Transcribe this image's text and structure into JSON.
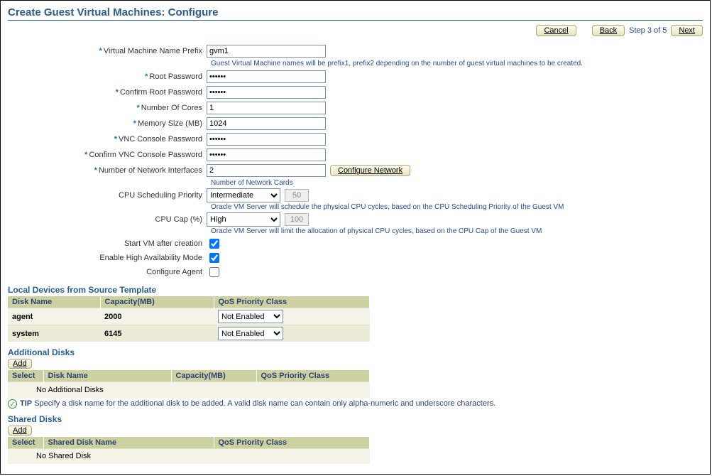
{
  "page": {
    "title": "Create Guest Virtual Machines: Configure",
    "step_text": "Step 3 of 5",
    "cancel": "Cancel",
    "back": "Back",
    "next": "Next"
  },
  "form": {
    "vm_name_label": "Virtual Machine Name Prefix",
    "vm_name_value": "gvm1",
    "vm_name_hint": "Guest Virtual Machine names will be prefix1, prefix2 depending on the number of guest virtual machines to be created.",
    "root_pw_label": "Root Password",
    "root_pw_value": "••••••",
    "confirm_root_pw_label": "Confirm Root Password",
    "confirm_root_pw_value": "••••••",
    "cores_label": "Number Of Cores",
    "cores_value": "1",
    "memory_label": "Memory Size (MB)",
    "memory_value": "1024",
    "vnc_pw_label": "VNC Console Password",
    "vnc_pw_value": "••••••",
    "confirm_vnc_pw_label": "Confirm VNC Console Password",
    "confirm_vnc_pw_value": "••••••",
    "nic_label": "Number of Network Interfaces",
    "nic_value": "2",
    "configure_network_btn": "Configure Network",
    "nic_hint": "Number of Network Cards",
    "cpu_sched_label": "CPU Scheduling Priority",
    "cpu_sched_value": "Intermediate",
    "cpu_sched_num": "50",
    "cpu_sched_hint": "Oracle VM Server will schedule the physical CPU cycles, based on the CPU Scheduling Priority of the Guest VM",
    "cpu_cap_label": "CPU Cap (%)",
    "cpu_cap_value": "High",
    "cpu_cap_num": "100",
    "cpu_cap_hint": "Oracle VM Server will limit the allocation of physical CPU cycles, based on the CPU Cap of the Guest VM",
    "start_vm_label": "Start VM after creation",
    "ha_label": "Enable High Availability Mode",
    "configure_agent_label": "Configure Agent"
  },
  "local_devices": {
    "title": "Local Devices from Source Template",
    "col_disk": "Disk Name",
    "col_capacity": "Capacity(MB)",
    "col_qos": "QoS Priority Class",
    "rows": [
      {
        "name": "agent",
        "capacity": "2000",
        "qos": "Not Enabled"
      },
      {
        "name": "system",
        "capacity": "6145",
        "qos": "Not Enabled"
      }
    ]
  },
  "additional_disks": {
    "title": "Additional Disks",
    "add_btn": "Add",
    "col_select": "Select",
    "col_disk": "Disk Name",
    "col_capacity": "Capacity(MB)",
    "col_qos": "QoS Priority Class",
    "empty_msg": "No Additional Disks",
    "tip_label": "TIP",
    "tip_text": "Specify a disk name for the additional disk to be added. A valid disk name can contain only alpha-numeric and underscore characters."
  },
  "shared_disks": {
    "title": "Shared Disks",
    "add_btn": "Add",
    "col_select": "Select",
    "col_disk": "Shared Disk Name",
    "col_qos": "QoS Priority Class",
    "empty_msg": "No Shared Disk"
  }
}
